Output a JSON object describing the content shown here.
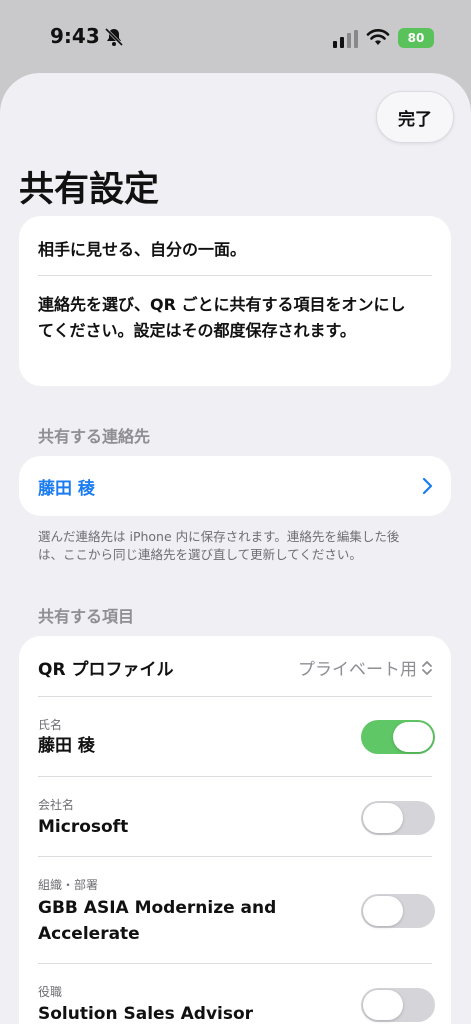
{
  "status_bar": {
    "time": "9:43",
    "battery": "80",
    "icons": [
      "bell-slash-icon",
      "cellular-signal-icon",
      "wifi-icon",
      "battery-charging-icon"
    ]
  },
  "header": {
    "done_label": "完了",
    "title": "共有設定"
  },
  "intro": {
    "headline": "相手に見せる、自分の一面。",
    "body": "連絡先を選び、QR ごとに共有する項目をオンにしてください。設定はその都度保存されます。"
  },
  "contact_section": {
    "header": "共有する連絡先",
    "selected_contact": "藤田 稜",
    "footnote": "選んだ連絡先は iPhone 内に保存されます。連絡先を編集した後は、ここから同じ連絡先を選び直して更新してください。"
  },
  "items_section": {
    "header": "共有する項目",
    "qr_profile_label": "QR プロファイル",
    "qr_profile_value": "プライベート用",
    "fields": [
      {
        "label": "氏名",
        "value": "藤田 稜",
        "enabled": true
      },
      {
        "label": "会社名",
        "value": "Microsoft",
        "enabled": false
      },
      {
        "label": "組織・部署",
        "value": "GBB ASIA Modernize and Accelerate",
        "enabled": false
      },
      {
        "label": "役職",
        "value": "Solution Sales Advisor",
        "enabled": false
      }
    ]
  },
  "colors": {
    "accent_blue": "#1a7cf0",
    "toggle_on": "#5fc765",
    "toggle_off": "#d5d5d9",
    "battery_green": "#5ac25a"
  }
}
